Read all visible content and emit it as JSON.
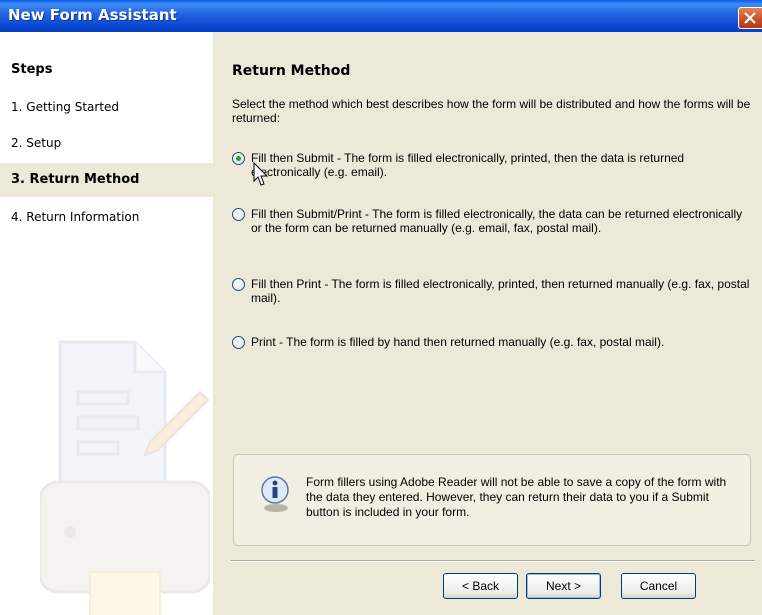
{
  "window": {
    "title": "New Form Assistant"
  },
  "sidebar": {
    "heading": "Steps",
    "steps": [
      {
        "label": "1. Getting Started",
        "active": false
      },
      {
        "label": "2. Setup",
        "active": false
      },
      {
        "label": "3. Return Method",
        "active": true
      },
      {
        "label": "4. Return Information",
        "active": false
      }
    ]
  },
  "main": {
    "title": "Return Method",
    "description": "Select the method which best describes how the form will be distributed and how the forms will be returned:",
    "options": [
      {
        "text": "Fill then Submit  -  The form is filled electronically, printed, then the data is returned electronically (e.g. email).",
        "checked": true
      },
      {
        "text": "Fill then Submit/Print  -  The form is filled electronically, the data can be returned electronically or the form can be returned manually (e.g. email, fax, postal mail).",
        "checked": false
      },
      {
        "text": "Fill then Print  -  The form is filled electronically, printed, then returned manually (e.g. fax, postal mail).",
        "checked": false
      },
      {
        "text": "Print  -  The form is filled by hand then returned manually (e.g. fax, postal mail).",
        "checked": false
      }
    ],
    "info": "Form fillers using Adobe Reader will not be able to save a copy of the form with the data they entered.  However, they can return their data to you if a Submit button is included in your form."
  },
  "buttons": {
    "back": "< Back",
    "next": "Next >",
    "cancel": "Cancel"
  },
  "colors": {
    "title_bar": "#0a48d2",
    "dialog_bg": "#ece9d8",
    "radio_selected": "#21a121"
  }
}
